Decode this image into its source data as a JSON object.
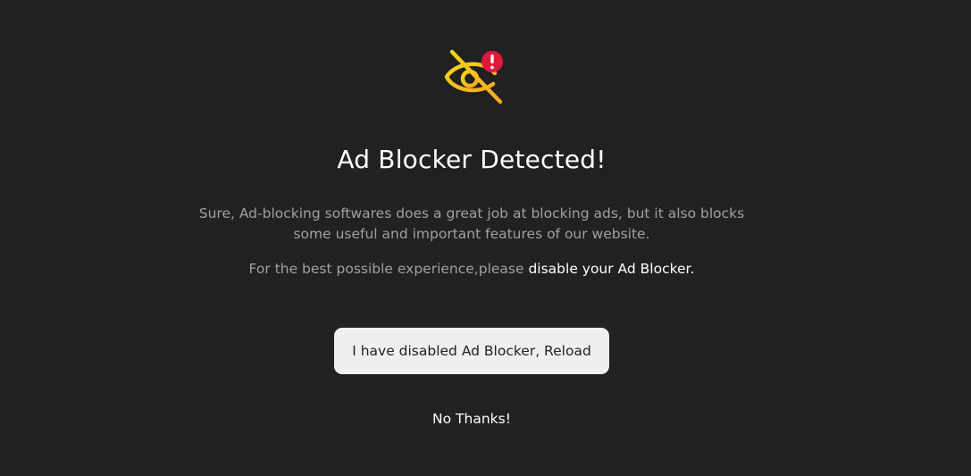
{
  "icon": "ad-blocker-eye-slash-alert-icon",
  "colors": {
    "background": "#212121",
    "icon_gradient_start": "#f6d21a",
    "icon_gradient_end": "#f5a623",
    "alert_badge": "#e0193a",
    "button_background": "#efefef"
  },
  "modal": {
    "title": "Ad Blocker Detected!",
    "description_line1": "Sure, Ad-blocking softwares does a great job at blocking ads, but it also blocks",
    "description_line2": "some useful and important features of our website.",
    "hint_prefix": "For the best possible experience,please ",
    "hint_emphasis": "disable your Ad Blocker.",
    "reload_button": "I have disabled Ad Blocker, Reload",
    "dismiss_link": "No Thanks!"
  }
}
